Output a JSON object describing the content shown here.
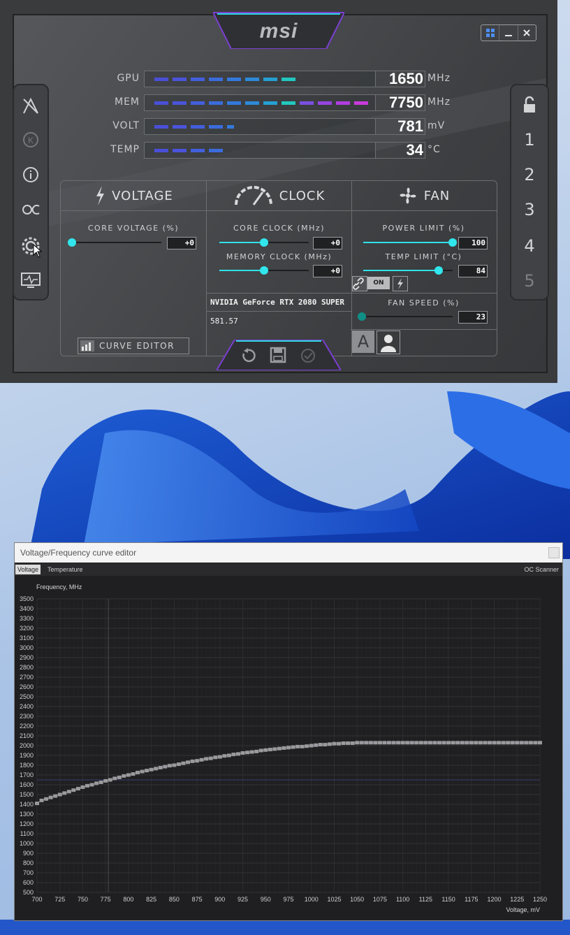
{
  "app": {
    "logo": "msi",
    "window_controls": [
      "windows-icon",
      "minimize",
      "close"
    ]
  },
  "monitors": [
    {
      "label": "GPU",
      "value": "1650",
      "unit": "MHz"
    },
    {
      "label": "MEM",
      "value": "7750",
      "unit": "MHz"
    },
    {
      "label": "VOLT",
      "value": "781",
      "unit": "mV"
    },
    {
      "label": "TEMP",
      "value": "34",
      "unit": "°C"
    }
  ],
  "profiles": [
    "1",
    "2",
    "3",
    "4",
    "5"
  ],
  "sections": {
    "voltage": {
      "title": "VOLTAGE",
      "core_voltage_label": "CORE VOLTAGE  (%)",
      "core_voltage_value": "+0",
      "curve_editor_label": "CURVE EDITOR"
    },
    "clock": {
      "title": "CLOCK",
      "core_clock_label": "CORE CLOCK (MHz)",
      "core_clock_value": "+0",
      "memory_clock_label": "MEMORY CLOCK (MHz)",
      "memory_clock_value": "+0",
      "gpu_name": "NVIDIA GeForce RTX 2080 SUPER",
      "driver": "581.57"
    },
    "fan": {
      "title": "FAN",
      "power_limit_label": "POWER LIMIT (%)",
      "power_limit_value": "100",
      "temp_limit_label": "TEMP LIMIT (°C)",
      "temp_limit_value": "84",
      "link_state": "ON",
      "fan_speed_label": "FAN SPEED (%)",
      "fan_speed_value": "23",
      "auto_label": "A"
    }
  },
  "levels": {
    "core_voltage": 0,
    "core_clock": 0.5,
    "memory_clock": 0.5,
    "power_limit": 1.0,
    "temp_limit": 0.84,
    "fan_speed": 0.0
  },
  "curve_editor": {
    "title": "Voltage/Frequency curve editor",
    "tabs": [
      "Voltage",
      "Temperature"
    ],
    "scanner": "OC Scanner",
    "ylabel": "Frequency, MHz",
    "xlabel": "Voltage, mV"
  },
  "chart_data": {
    "type": "scatter",
    "xlabel": "Voltage, mV",
    "ylabel": "Frequency, MHz",
    "xlim": [
      700,
      1250
    ],
    "ylim": [
      500,
      3500
    ],
    "x_ticks": [
      700,
      725,
      750,
      775,
      800,
      825,
      850,
      875,
      900,
      925,
      950,
      975,
      1000,
      1025,
      1050,
      1075,
      1100,
      1125,
      1150,
      1175,
      1200,
      1225,
      1250
    ],
    "y_ticks": [
      500,
      600,
      700,
      800,
      900,
      1000,
      1100,
      1200,
      1300,
      1400,
      1500,
      1600,
      1700,
      1800,
      1900,
      2000,
      2100,
      2200,
      2300,
      2400,
      2500,
      2600,
      2700,
      2800,
      2900,
      3000,
      3100,
      3200,
      3300,
      3400,
      3500
    ],
    "x": [
      700,
      705,
      710,
      715,
      720,
      725,
      730,
      735,
      740,
      745,
      750,
      755,
      760,
      765,
      770,
      775,
      780,
      785,
      790,
      795,
      800,
      805,
      810,
      815,
      820,
      825,
      830,
      835,
      840,
      845,
      850,
      855,
      860,
      865,
      870,
      875,
      880,
      885,
      890,
      895,
      900,
      905,
      910,
      915,
      920,
      925,
      930,
      935,
      940,
      945,
      950,
      955,
      960,
      965,
      970,
      975,
      980,
      985,
      990,
      995,
      1000,
      1005,
      1010,
      1015,
      1020,
      1025,
      1030,
      1035,
      1040,
      1045,
      1050,
      1055,
      1060,
      1065,
      1070,
      1075,
      1080,
      1085,
      1090,
      1095,
      1100,
      1105,
      1110,
      1115,
      1120,
      1125,
      1130,
      1135,
      1140,
      1145,
      1150,
      1155,
      1160,
      1165,
      1170,
      1175,
      1180,
      1185,
      1190,
      1195,
      1200,
      1205,
      1210,
      1215,
      1220,
      1225,
      1230,
      1235,
      1240,
      1245,
      1250
    ],
    "y": [
      1410,
      1440,
      1455,
      1470,
      1485,
      1500,
      1515,
      1530,
      1545,
      1560,
      1575,
      1590,
      1600,
      1615,
      1625,
      1640,
      1650,
      1665,
      1675,
      1690,
      1700,
      1710,
      1725,
      1735,
      1745,
      1755,
      1765,
      1775,
      1785,
      1795,
      1800,
      1810,
      1820,
      1830,
      1840,
      1845,
      1855,
      1865,
      1870,
      1880,
      1885,
      1895,
      1900,
      1910,
      1915,
      1925,
      1930,
      1935,
      1940,
      1950,
      1955,
      1960,
      1965,
      1970,
      1975,
      1980,
      1985,
      1990,
      1990,
      1995,
      2000,
      2005,
      2010,
      2010,
      2015,
      2020,
      2020,
      2025,
      2025,
      2025,
      2030,
      2030,
      2030,
      2030,
      2030,
      2030,
      2030,
      2030,
      2030,
      2030,
      2030,
      2030,
      2030,
      2030,
      2030,
      2030,
      2030,
      2030,
      2030,
      2030,
      2030,
      2030,
      2030,
      2030,
      2030,
      2030,
      2030,
      2030,
      2030,
      2030,
      2030,
      2030,
      2030,
      2030,
      2030,
      2030,
      2030,
      2030,
      2030,
      2030,
      2030
    ],
    "marker_line": {
      "y": 1650,
      "x": 778
    },
    "grid": true
  }
}
